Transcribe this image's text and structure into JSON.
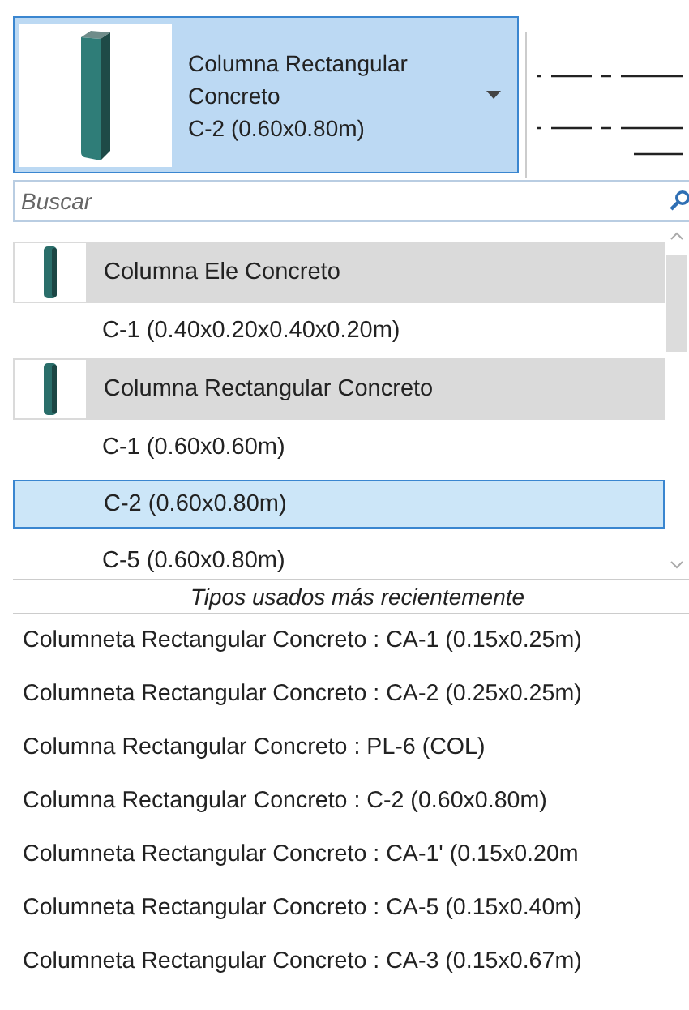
{
  "selector": {
    "family": "Columna Rectangular Concreto",
    "type": "C-2 (0.60x0.80m)"
  },
  "search": {
    "placeholder": "Buscar"
  },
  "list": [
    {
      "kind": "family",
      "label": "Columna Ele Concreto",
      "selected": false
    },
    {
      "kind": "type",
      "label": "C-1 (0.40x0.20x0.40x0.20m)",
      "selected": false
    },
    {
      "kind": "family",
      "label": "Columna Rectangular Concreto",
      "selected": false
    },
    {
      "kind": "type",
      "label": "C-1 (0.60x0.60m)",
      "selected": false
    },
    {
      "kind": "type",
      "label": "C-2 (0.60x0.80m)",
      "selected": true
    },
    {
      "kind": "type",
      "label": "C-5 (0.60x0.80m)",
      "selected": false
    }
  ],
  "recent": {
    "heading": "Tipos usados más recientemente",
    "items": [
      "Columneta Rectangular Concreto : CA-1 (0.15x0.25m)",
      "Columneta Rectangular Concreto : CA-2 (0.25x0.25m)",
      "Columna Rectangular Concreto : PL-6 (COL)",
      "Columna Rectangular Concreto : C-2 (0.60x0.80m)",
      "Columneta Rectangular Concreto : CA-1' (0.15x0.20m",
      "Columneta Rectangular Concreto : CA-5 (0.15x0.40m)",
      "Columneta Rectangular Concreto : CA-3 (0.15x0.67m)"
    ]
  }
}
